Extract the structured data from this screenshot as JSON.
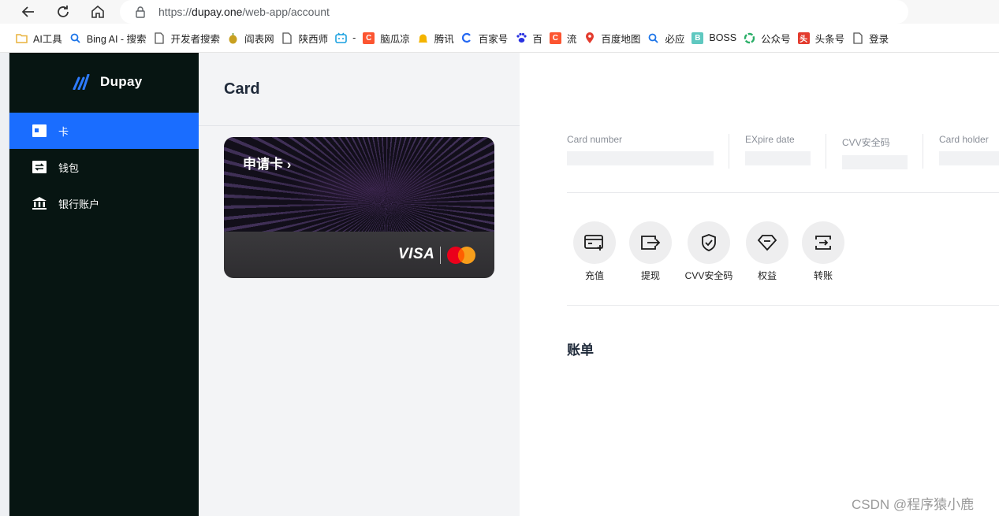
{
  "browser": {
    "url_prefix": "https://",
    "url_host": "dupay.one",
    "url_path": "/web-app/account"
  },
  "bookmarks": [
    {
      "label": "AI工具",
      "icon": "folder-icon",
      "color": "#e8b23c"
    },
    {
      "label": "Bing AI - 搜索",
      "icon": "search-icon",
      "color": "#1a73e8"
    },
    {
      "label": "开发者搜索",
      "icon": "page-icon",
      "color": "#555555"
    },
    {
      "label": "阎表网",
      "icon": "site-icon",
      "color": "#c8a020"
    },
    {
      "label": "陕西师",
      "icon": "page-icon",
      "color": "#555555"
    },
    {
      "label": "-",
      "icon": "bilibili-icon",
      "color": "#1aa1e0"
    },
    {
      "label": "脑瓜凉",
      "icon": "csdn-icon",
      "color": "#fc5531"
    },
    {
      "label": "腾讯",
      "icon": "qq-icon",
      "color": "#f4b400"
    },
    {
      "label": "百家号",
      "icon": "baijia-icon",
      "color": "#2468f2"
    },
    {
      "label": "百",
      "icon": "baidu-icon",
      "color": "#2932e1"
    },
    {
      "label": "流",
      "icon": "csdn-icon",
      "color": "#fc5531"
    },
    {
      "label": "百度地图",
      "icon": "map-pin-icon",
      "color": "#e33b2e"
    },
    {
      "label": "必应",
      "icon": "search-icon",
      "color": "#1a73e8"
    },
    {
      "label": "BOSS",
      "icon": "boss-icon",
      "color": "#5fc8c0"
    },
    {
      "label": "公众号",
      "icon": "wechat-icon",
      "color": "#2aae67"
    },
    {
      "label": "头条号",
      "icon": "toutiao-icon",
      "color": "#e33b2e"
    },
    {
      "label": "登录",
      "icon": "page-icon",
      "color": "#555555"
    }
  ],
  "sidebar": {
    "logo": "Dupay",
    "items": [
      {
        "label": "卡",
        "icon": "card-icon",
        "active": true
      },
      {
        "label": "钱包",
        "icon": "wallet-icon",
        "active": false
      },
      {
        "label": "银行账户",
        "icon": "bank-icon",
        "active": false
      }
    ]
  },
  "card_panel": {
    "title": "Card",
    "apply_label": "申请卡 ›",
    "visa": "VISA"
  },
  "details": {
    "fields": [
      {
        "label": "Card number"
      },
      {
        "label": "EXpire date"
      },
      {
        "label": "CVV安全码"
      },
      {
        "label": "Card holder"
      }
    ],
    "actions": [
      {
        "label": "充值",
        "icon": "top-up-icon"
      },
      {
        "label": "提现",
        "icon": "withdraw-icon"
      },
      {
        "label": "CVV安全码",
        "icon": "shield-check-icon"
      },
      {
        "label": "权益",
        "icon": "diamond-icon"
      },
      {
        "label": "转账",
        "icon": "transfer-icon"
      }
    ],
    "bill_title": "账单"
  },
  "colors": {
    "accent": "#1a6dff",
    "sidebar_bg": "#071512"
  },
  "watermark": "CSDN @程序猿小鹿"
}
